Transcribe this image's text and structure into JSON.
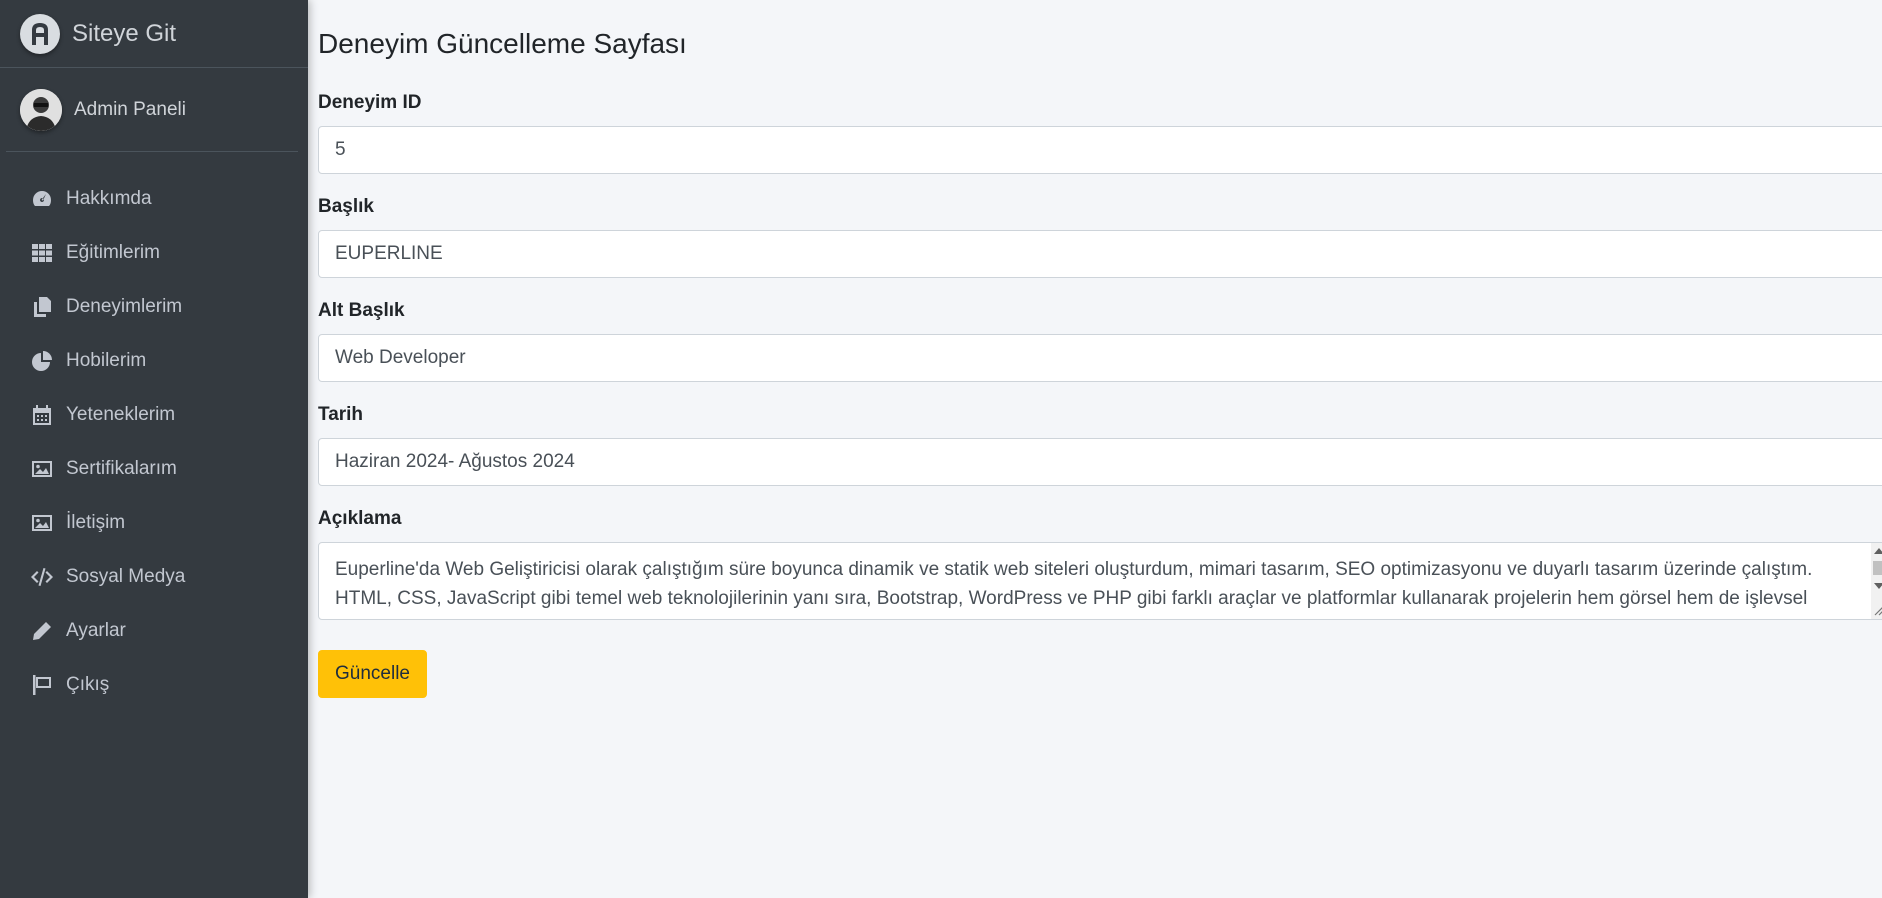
{
  "brand": {
    "text": "Siteye Git"
  },
  "user": {
    "name": "Admin Paneli"
  },
  "nav": [
    {
      "label": "Hakkımda",
      "icon": "tachometer-icon"
    },
    {
      "label": "Eğitimlerim",
      "icon": "grid-icon"
    },
    {
      "label": "Deneyimlerim",
      "icon": "copy-icon"
    },
    {
      "label": "Hobilerim",
      "icon": "pie-chart-icon"
    },
    {
      "label": "Yeteneklerim",
      "icon": "calendar-icon"
    },
    {
      "label": "Sertifikalarım",
      "icon": "image-icon"
    },
    {
      "label": "İletişim",
      "icon": "image-icon"
    },
    {
      "label": "Sosyal Medya",
      "icon": "code-icon"
    },
    {
      "label": "Ayarlar",
      "icon": "pencil-icon"
    },
    {
      "label": "Çıkış",
      "icon": "flag-icon"
    }
  ],
  "page": {
    "title": "Deneyim Güncelleme Sayfası"
  },
  "form": {
    "id": {
      "label": "Deneyim ID",
      "value": "5"
    },
    "title": {
      "label": "Başlık",
      "value": "EUPERLINE"
    },
    "subtitle": {
      "label": "Alt Başlık",
      "value": "Web Developer"
    },
    "date": {
      "label": "Tarih",
      "value": "Haziran 2024- Ağustos 2024"
    },
    "description": {
      "label": "Açıklama",
      "value": "Euperline'da Web Geliştiricisi olarak çalıştığım süre boyunca dinamik ve statik web siteleri oluşturdum, mimari tasarım, SEO optimizasyonu ve duyarlı tasarım üzerinde çalıştım. HTML, CSS, JavaScript gibi temel web teknolojilerinin yanı sıra, Bootstrap, WordPress ve PHP gibi farklı araçlar ve platformlar kullanarak projelerin hem görsel hem de işlevsel açıdan"
    },
    "submit_label": "Güncelle"
  },
  "colors": {
    "sidebar_bg": "#343a40",
    "main_bg": "#f4f6f9",
    "button_warning": "#ffc107"
  }
}
